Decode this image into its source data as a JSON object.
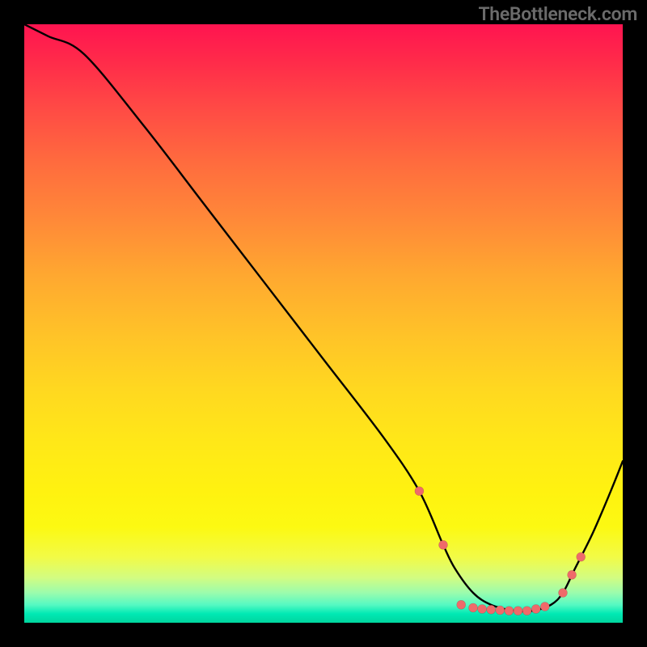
{
  "watermark": "TheBottleneck.com",
  "chart_data": {
    "type": "line",
    "title": "",
    "xlabel": "",
    "ylabel": "",
    "xlim": [
      0,
      100
    ],
    "ylim": [
      0,
      100
    ],
    "series": [
      {
        "name": "curve",
        "x": [
          0,
          4,
          10,
          20,
          30,
          40,
          50,
          60,
          66,
          70,
          72,
          75,
          78,
          82,
          85,
          88,
          90,
          92,
          95,
          98,
          100
        ],
        "y": [
          100,
          98,
          95,
          83,
          70,
          57,
          44,
          31,
          22,
          13,
          9,
          5,
          3,
          2,
          2,
          3,
          5,
          9,
          15,
          22,
          27
        ]
      }
    ],
    "markers": [
      {
        "x": 66,
        "y": 22
      },
      {
        "x": 70,
        "y": 13
      },
      {
        "x": 73,
        "y": 3
      },
      {
        "x": 75,
        "y": 2.5
      },
      {
        "x": 76.5,
        "y": 2.3
      },
      {
        "x": 78,
        "y": 2.2
      },
      {
        "x": 79.5,
        "y": 2.1
      },
      {
        "x": 81,
        "y": 2.0
      },
      {
        "x": 82.5,
        "y": 2.0
      },
      {
        "x": 84,
        "y": 2.0
      },
      {
        "x": 85.5,
        "y": 2.3
      },
      {
        "x": 87,
        "y": 2.7
      },
      {
        "x": 90,
        "y": 5
      },
      {
        "x": 91.5,
        "y": 8
      },
      {
        "x": 93,
        "y": 11
      }
    ],
    "gradient_stops": [
      {
        "pos": 0.0,
        "color": "#ff1450"
      },
      {
        "pos": 0.5,
        "color": "#ffc328"
      },
      {
        "pos": 0.85,
        "color": "#fcf912"
      },
      {
        "pos": 1.0,
        "color": "#00d59e"
      }
    ]
  }
}
